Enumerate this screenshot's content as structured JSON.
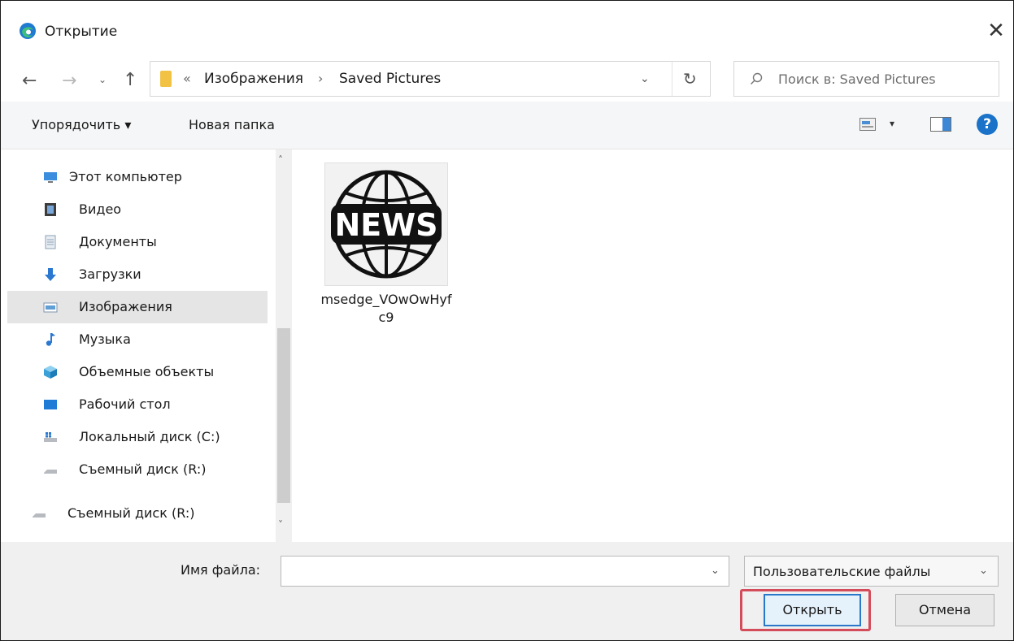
{
  "window": {
    "title": "Открытие",
    "close_glyph": "✕"
  },
  "nav": {
    "back_glyph": "←",
    "forward_glyph": "→",
    "recent_glyph": "⌄",
    "up_glyph": "↑",
    "breadcrumb": {
      "overflow_glyph": "«",
      "separator": "›",
      "items": [
        "Изображения",
        "Saved Pictures"
      ]
    },
    "dropdown_glyph": "⌄",
    "refresh_glyph": "↻",
    "search_placeholder": "Поиск в: Saved Pictures"
  },
  "toolbar": {
    "organize_label": "Упорядочить ▾",
    "new_folder_label": "Новая папка",
    "view_arrow": "▾",
    "help_label": "?"
  },
  "sidebar": {
    "items": [
      {
        "label": "Этот компьютер",
        "icon": "computer-icon"
      },
      {
        "label": "Видео",
        "icon": "video-icon"
      },
      {
        "label": "Документы",
        "icon": "documents-icon"
      },
      {
        "label": "Загрузки",
        "icon": "downloads-icon"
      },
      {
        "label": "Изображения",
        "icon": "pictures-icon",
        "selected": true
      },
      {
        "label": "Музыка",
        "icon": "music-icon"
      },
      {
        "label": "Объемные объекты",
        "icon": "3d-objects-icon"
      },
      {
        "label": "Рабочий стол",
        "icon": "desktop-icon"
      },
      {
        "label": "Локальный диск (C:)",
        "icon": "local-disk-icon"
      },
      {
        "label": "Съемный диск (R:)",
        "icon": "removable-disk-icon"
      },
      {
        "label": "Съемный диск (R:)",
        "icon": "removable-disk-icon"
      }
    ],
    "scroll_up": "˄",
    "scroll_down": "˅"
  },
  "files": [
    {
      "name": "msedge_VOwOwHyfc9",
      "thumb_text": "NEWS",
      "icon": "news-globe-icon"
    }
  ],
  "bottom": {
    "filename_label": "Имя файла:",
    "filename_value": "",
    "filename_arrow": "⌄",
    "filetype_value": "Пользовательские файлы",
    "filetype_arrow": "⌄",
    "open_label": "Открыть",
    "cancel_label": "Отмена"
  },
  "colors": {
    "highlight": "#d44b5a",
    "primary_button_border": "#2a78c9",
    "selected_row": "#e5e5e5"
  }
}
